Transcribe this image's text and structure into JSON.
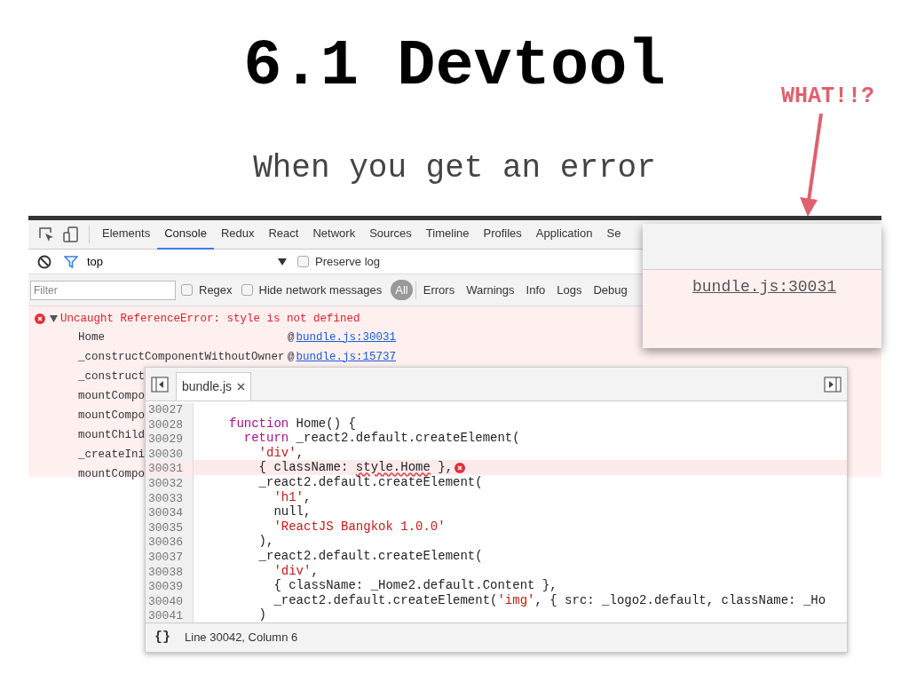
{
  "slide": {
    "title": "6.1 Devtool",
    "subtitle": "When you get an error",
    "callout": "WHAT!!?"
  },
  "devtools": {
    "tabs": [
      {
        "label": "Elements",
        "selected": false
      },
      {
        "label": "Console",
        "selected": true
      },
      {
        "label": "Redux",
        "selected": false
      },
      {
        "label": "React",
        "selected": false
      },
      {
        "label": "Network",
        "selected": false
      },
      {
        "label": "Sources",
        "selected": false
      },
      {
        "label": "Timeline",
        "selected": false
      },
      {
        "label": "Profiles",
        "selected": false
      },
      {
        "label": "Application",
        "selected": false
      },
      {
        "label": "Se",
        "selected": false
      }
    ],
    "context": "top",
    "preserve_log": {
      "label": "Preserve log",
      "checked": false
    },
    "filter": {
      "placeholder": "Filter"
    },
    "options": [
      {
        "label": "Regex",
        "checked": false
      },
      {
        "label": "Hide network messages",
        "checked": false
      }
    ],
    "levels": [
      {
        "label": "All",
        "selected": true
      },
      {
        "label": "Errors",
        "selected": false
      },
      {
        "label": "Warnings",
        "selected": false
      },
      {
        "label": "Info",
        "selected": false
      },
      {
        "label": "Logs",
        "selected": false
      },
      {
        "label": "Debug",
        "selected": false
      }
    ],
    "error": {
      "message": "Uncaught ReferenceError: style is not defined",
      "expanded": true,
      "frames": [
        {
          "name": "Home",
          "at": "@",
          "link": "bundle.js:30031"
        },
        {
          "name": "_constructComponentWithoutOwner",
          "at": "@",
          "link": "bundle.js:15737"
        },
        {
          "name": "_construct"
        },
        {
          "name": "mountCompo"
        },
        {
          "name": "mountCompo"
        },
        {
          "name": "mountChild"
        },
        {
          "name": "_createIni"
        },
        {
          "name": "mountCompo"
        }
      ]
    }
  },
  "editor": {
    "file_tab": "bundle.js",
    "lines": [
      {
        "number": "30027",
        "error": false
      },
      {
        "number": "30028",
        "error": false,
        "tokens": [
          {
            "kind": "keyword",
            "text": "function"
          },
          {
            "kind": "plain",
            "text": " Home() {"
          }
        ]
      },
      {
        "number": "30029",
        "error": false,
        "tokens": [
          {
            "kind": "keyword",
            "text": "  return"
          },
          {
            "kind": "plain",
            "text": " _react2.default.createElement("
          }
        ]
      },
      {
        "number": "30030",
        "error": false,
        "tokens": [
          {
            "kind": "string",
            "text": "    'div'"
          },
          {
            "kind": "plain",
            "text": ","
          }
        ]
      },
      {
        "number": "30031",
        "error": true,
        "tokens": [
          {
            "kind": "plain",
            "text": "    { className: "
          },
          {
            "kind": "squiggle",
            "text": "style.Home"
          },
          {
            "kind": "plain",
            "text": " },"
          }
        ]
      },
      {
        "number": "30032",
        "error": false,
        "tokens": [
          {
            "kind": "plain",
            "text": "    _react2.default.createElement("
          }
        ]
      },
      {
        "number": "30033",
        "error": false,
        "tokens": [
          {
            "kind": "string",
            "text": "      'h1'"
          },
          {
            "kind": "plain",
            "text": ","
          }
        ]
      },
      {
        "number": "30034",
        "error": false,
        "tokens": [
          {
            "kind": "plain",
            "text": "      null,"
          }
        ]
      },
      {
        "number": "30035",
        "error": false,
        "tokens": [
          {
            "kind": "string",
            "text": "      'ReactJS Bangkok 1.0.0'"
          }
        ]
      },
      {
        "number": "30036",
        "error": false,
        "tokens": [
          {
            "kind": "plain",
            "text": "    ),"
          }
        ]
      },
      {
        "number": "30037",
        "error": false,
        "tokens": [
          {
            "kind": "plain",
            "text": "    _react2.default.createElement("
          }
        ]
      },
      {
        "number": "30038",
        "error": false,
        "tokens": [
          {
            "kind": "string",
            "text": "      'div'"
          },
          {
            "kind": "plain",
            "text": ","
          }
        ]
      },
      {
        "number": "30039",
        "error": false,
        "tokens": [
          {
            "kind": "plain",
            "text": "      { className: _Home2.default.Content },"
          }
        ]
      },
      {
        "number": "30040",
        "error": false,
        "tokens": [
          {
            "kind": "plain",
            "text": "      _react2.default.createElement("
          },
          {
            "kind": "string",
            "text": "'img'"
          },
          {
            "kind": "plain",
            "text": ", { src: _logo2.default, className: _Ho"
          }
        ]
      },
      {
        "number": "30041",
        "error": false,
        "tokens": [
          {
            "kind": "plain",
            "text": "    )"
          }
        ]
      }
    ],
    "format_button": "{}",
    "position": "Line 30042, Column 6"
  },
  "zoom_popup": {
    "link": "bundle.js:30031"
  }
}
